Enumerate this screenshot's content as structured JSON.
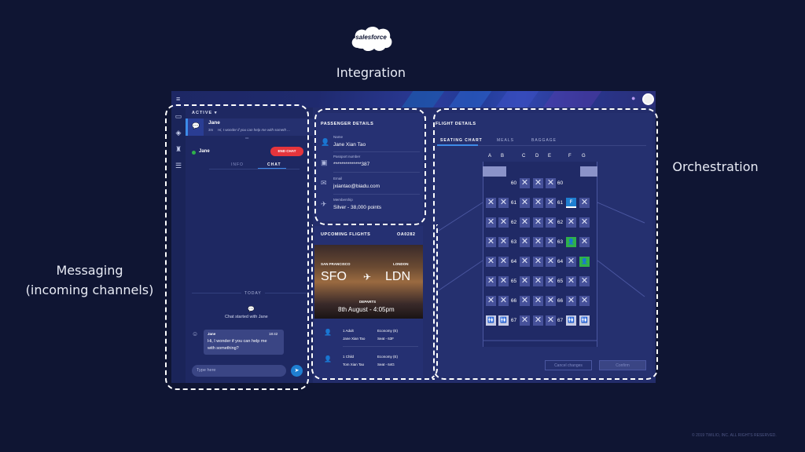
{
  "slide": {
    "logo_text": "salesforce",
    "integration_label": "Integration",
    "orchestration_label": "Orchestration",
    "messaging_label_line1": "Messaging",
    "messaging_label_line2": "(incoming channels)",
    "copyright": "© 2019 TWILIO, INC. ALL RIGHTS RESERVED."
  },
  "chat": {
    "status_dropdown": "ACTIVE",
    "task_name": "Jane",
    "task_age": "3m",
    "task_preview": "Hi, I wonder if you can help me with someth ...",
    "contact_name": "Jane",
    "end_chat_label": "END CHAT",
    "tabs": [
      "INFO",
      "CHAT"
    ],
    "active_tab": "CHAT",
    "day_divider": "TODAY",
    "started_text": "Chat started with Jane",
    "message": {
      "author": "Jane",
      "time": "18:42",
      "text_line1": "Hi, I wonder if you can help me",
      "text_line2": "with something?"
    },
    "input_placeholder": "Type here"
  },
  "passenger": {
    "title": "PASSENGER DETAILS",
    "fields": [
      {
        "label": "Name",
        "value": "Jane Xian Tao",
        "icon": "person-icon"
      },
      {
        "label": "Passport number",
        "value": "**************387",
        "icon": "passport-icon"
      },
      {
        "label": "Email",
        "value": "jxiantao@biadu.com",
        "icon": "mail-icon"
      },
      {
        "label": "Membership",
        "value": "Silver - 38,000 points",
        "icon": "plane-icon"
      }
    ]
  },
  "upcoming": {
    "title": "UPCOMING FLIGHTS",
    "flight_no": "OA0282",
    "from_city": "SAN FRANCISCO",
    "to_city": "LONDON",
    "from_code": "SFO",
    "to_code": "LDN",
    "departs_label": "DEPARTS",
    "departs_value": "8th August - 4:05pm",
    "passengers": [
      {
        "count": "1 Adult",
        "name": "Jane Xian Tao",
        "class": "Economy (E)",
        "seat": "Seat - 63F"
      },
      {
        "count": "1 Child",
        "name": "Tom Xian Tao",
        "class": "Economy (E)",
        "seat": "Seat - 64G"
      }
    ]
  },
  "flight_details": {
    "title": "FLIGHT DETAILS",
    "tabs": [
      "SEATING CHART",
      "MEALS",
      "BAGGAGE"
    ],
    "active_tab": "SEATING CHART",
    "columns": [
      "A",
      "B",
      "C",
      "D",
      "E",
      "F",
      "G"
    ],
    "rows": [
      "60",
      "61",
      "62",
      "63",
      "64",
      "65",
      "66",
      "67"
    ],
    "selected_seat_label": "F",
    "cancel_label": "Cancel changes",
    "confirm_label": "Confirm"
  },
  "colors": {
    "background": "#0f1533",
    "accent_red": "#e5353c",
    "seat_green": "#2fb14a",
    "seat_blue": "#1f7fd1"
  }
}
